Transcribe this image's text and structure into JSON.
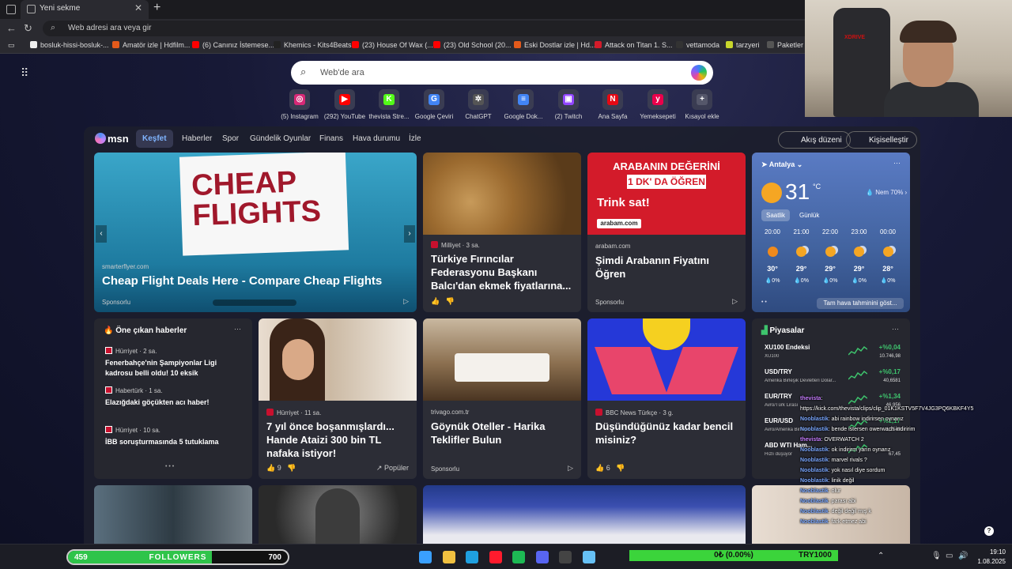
{
  "browser": {
    "tab_title": "Yeni sekme",
    "tab_close": "✕",
    "new_tab": "+",
    "address_placeholder": "Web adresi ara veya gir",
    "bookmarks": [
      {
        "label": "bosluk-hissi-bosluk-...",
        "color": "#eeeeee"
      },
      {
        "label": "Amatör izle | Hdfilm...",
        "color": "#e35a1b"
      },
      {
        "label": "(6) Canınız İstemese...",
        "color": "#ff0000"
      },
      {
        "label": "Khemics - Kits4Beats",
        "color": "#222222"
      },
      {
        "label": "(23) House Of Wax (...",
        "color": "#ff0000"
      },
      {
        "label": "(23) Old School (20...",
        "color": "#ff0000"
      },
      {
        "label": "Eski Dostlar izle | Hd...",
        "color": "#e35a1b"
      },
      {
        "label": "Attack on Titan 1. S...",
        "color": "#d31b2a"
      },
      {
        "label": "vettamoda",
        "color": "#333333"
      },
      {
        "label": "tarzyeri",
        "color": "#c8d62b"
      },
      {
        "label": "Paketler",
        "color": "#555555"
      }
    ]
  },
  "newtab": {
    "search_placeholder": "Web'de ara",
    "shortcuts": [
      {
        "label": "(5) Instagram",
        "color": "#d62976",
        "glyph": "◎"
      },
      {
        "label": "(292) YouTube",
        "color": "#ff0000",
        "glyph": "▶"
      },
      {
        "label": "thevista Stre...",
        "color": "#53fc18",
        "glyph": "K"
      },
      {
        "label": "Google Çeviri",
        "color": "#4285f4",
        "glyph": "G"
      },
      {
        "label": "ChatGPT",
        "color": "#555555",
        "glyph": "✲"
      },
      {
        "label": "Google Dok...",
        "color": "#4285f4",
        "glyph": "≡"
      },
      {
        "label": "(2) Twitch",
        "color": "#9146ff",
        "glyph": "▣"
      },
      {
        "label": "Ana Sayfa",
        "color": "#e50914",
        "glyph": "N"
      },
      {
        "label": "Yemeksepeti",
        "color": "#ea004b",
        "glyph": "y"
      },
      {
        "label": "Kısayol ekle",
        "color": "#55576a",
        "glyph": "+"
      }
    ]
  },
  "msn": {
    "logo": "msn",
    "nav": [
      "Keşfet",
      "Haberler",
      "Spor",
      "Gündelik Oyunlar",
      "Finans",
      "Hava durumu",
      "İzle"
    ],
    "feed_layout": "Akış düzeni",
    "personalize": "Kişiselleştir",
    "hero": {
      "sign_text": "CHEAP FLIGHTS",
      "source": "smarterflyer.com",
      "title": "Cheap Flight Deals Here - Compare Cheap Flights",
      "sponsored": "Sponsorlu"
    },
    "card_bread": {
      "source": "Milliyet · 3 sa.",
      "title": "Türkiye Fırıncılar Federasyonu Başkanı Balcı'dan ekmek fiyatlarına..."
    },
    "card_car": {
      "ad_line1": "ARABANIN DEĞERİNİ",
      "ad_line2": "1 DK' DA ÖĞREN",
      "ad_line3": "Trink sat!",
      "ad_logo": "arabam.com",
      "source": "arabam.com",
      "title": "Şimdi Arabanın Fiyatını Öğren",
      "sponsored": "Sponsorlu"
    },
    "weather": {
      "location": "Antalya",
      "temp": "31",
      "unit": "°C",
      "humidity": "Nem 70%",
      "tab_hourly": "Saatlik",
      "tab_daily": "Günlük",
      "hours": [
        {
          "time": "20:00",
          "temp": "30°",
          "rain": "0%",
          "icon": "sun"
        },
        {
          "time": "21:00",
          "temp": "29°",
          "rain": "0%",
          "icon": "moon"
        },
        {
          "time": "22:00",
          "temp": "29°",
          "rain": "0%",
          "icon": "moon"
        },
        {
          "time": "23:00",
          "temp": "29°",
          "rain": "0%",
          "icon": "moon"
        },
        {
          "time": "00:00",
          "temp": "28°",
          "rain": "0%",
          "icon": "moon"
        }
      ],
      "full_forecast": "Tam hava tahminini göst..."
    },
    "top_news": {
      "title": "Öne çıkan haberler",
      "items": [
        {
          "source": "Hürriyet · 2 sa.",
          "headline": "Fenerbahçe'nin Şampiyonlar Ligi kadrosu belli oldu! 10 eksik"
        },
        {
          "source": "Habertürk · 1 sa.",
          "headline": "Elazığdaki göçükten acı haber!"
        },
        {
          "source": "Hürriyet · 10 sa.",
          "headline": "İBB soruşturmasında 5 tutuklama"
        }
      ]
    },
    "card_divorce": {
      "source": "Hürriyet · 11 sa.",
      "title": "7 yıl önce boşanmışlardı... Hande Ataizi 300 bin TL nafaka istiyor!",
      "likes": "9",
      "popular": "Popüler"
    },
    "card_hotel": {
      "source": "trivago.com.tr",
      "title": "Göynük Oteller - Harika Teklifler Bulun",
      "sponsored": "Sponsorlu"
    },
    "card_bbc": {
      "source": "BBC News Türkçe · 3 g.",
      "title": "Düşündüğünüz kadar bencil misiniz?",
      "likes": "6"
    },
    "markets": {
      "title": "Piyasalar",
      "items": [
        {
          "name": "XU100 Endeksi",
          "desc": "XU100",
          "change": "+%0,04",
          "value": "10.746,98"
        },
        {
          "name": "USD/TRY",
          "desc": "Amerika Birleşik Devletleri Dolar...",
          "change": "+%0,17",
          "value": "40,6581"
        },
        {
          "name": "EUR/TRY",
          "desc": "Avro/Türk Lirası",
          "change": "+%1,34",
          "value": "46,956"
        },
        {
          "name": "EUR/USD",
          "desc": "Avro/Amerika Birleşik...",
          "change": "+%1,17",
          "value": "1,1549"
        },
        {
          "name": "ABD WTI Ham...",
          "desc": "Hızlı düşüyor",
          "change": "",
          "value": "67,45"
        }
      ]
    }
  },
  "stream": {
    "chair_logo": "XDRIVE",
    "chat": [
      {
        "user": "thevista",
        "text": ":",
        "kind": "streamer"
      },
      {
        "user": "",
        "text": "https://kick.com/thevista/clips/clip_01K1KSTV5F7V4JG3PQ6KBKF4Y5",
        "kind": "plain"
      },
      {
        "user": "Nooblastik",
        "text": ": abi rainbow indirirsen oynarız",
        "kind": "user"
      },
      {
        "user": "Nooblastik",
        "text": ": bende istersen owerwach indiririm",
        "kind": "user"
      },
      {
        "user": "thevista",
        "text": ": OVERWATCH 2",
        "kind": "streamer"
      },
      {
        "user": "Nooblastik",
        "text": ": ok indirirm yarın oynarız",
        "kind": "user"
      },
      {
        "user": "Nooblastik",
        "text": ": marvel rivals ?",
        "kind": "user"
      },
      {
        "user": "Nooblastik",
        "text": ": yok nasıl diye sordum",
        "kind": "user"
      },
      {
        "user": "Nooblastik",
        "text": ": linik değil",
        "kind": "user"
      },
      {
        "user": "Nooblastik",
        "text": ": olur",
        "kind": "user"
      },
      {
        "user": "Nooblastik",
        "text": ": parası abi",
        "kind": "user"
      },
      {
        "user": "Nooblastik",
        "text": ": değil değil mış k",
        "kind": "user"
      },
      {
        "user": "Nooblastik",
        "text": ": fark etmez abi",
        "kind": "user"
      }
    ],
    "followers": {
      "current": "459",
      "label": "FOLLOWERS",
      "goal": "700",
      "progress": 0.656
    },
    "ticker": {
      "value": "0₺ (0.00%)",
      "right": "TRY1000"
    }
  },
  "taskbar": {
    "time": "19:10",
    "date": "1.08.2025",
    "apps": [
      {
        "name": "windows",
        "color": "#3aa0ff"
      },
      {
        "name": "explorer",
        "color": "#f0c040"
      },
      {
        "name": "edge",
        "color": "#1fa0e0"
      },
      {
        "name": "opera",
        "color": "#ff1b2d"
      },
      {
        "name": "spotify",
        "color": "#1db954"
      },
      {
        "name": "discord",
        "color": "#5865f2"
      },
      {
        "name": "obs",
        "color": "#444444"
      },
      {
        "name": "steam",
        "color": "#66c0f4"
      }
    ]
  }
}
